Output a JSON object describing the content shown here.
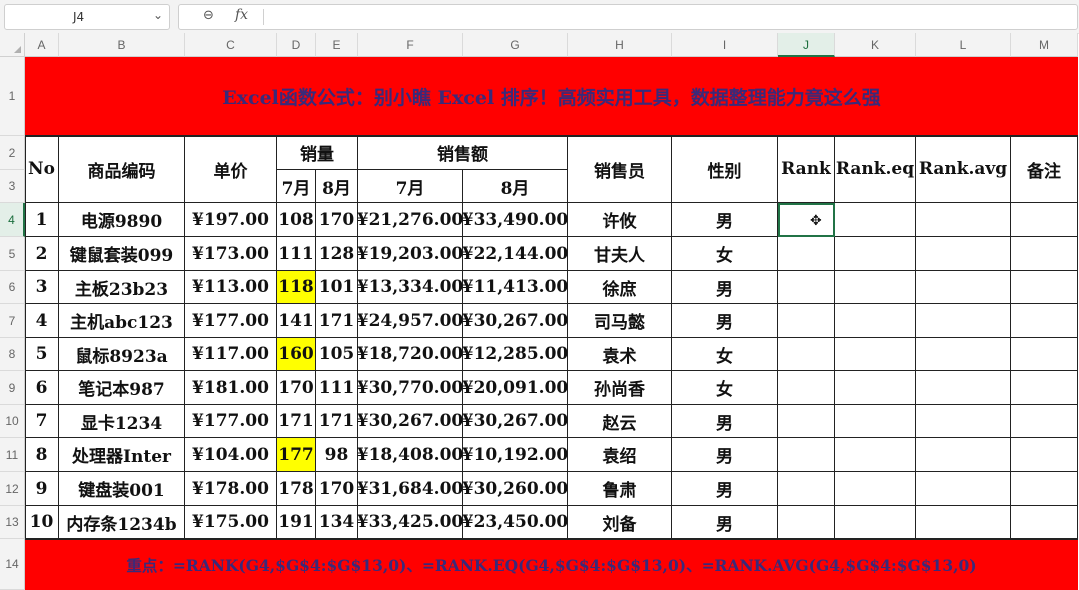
{
  "name_box": "J4",
  "formula": "",
  "columns": [
    "A",
    "B",
    "C",
    "D",
    "E",
    "F",
    "G",
    "H",
    "I",
    "J",
    "K",
    "L",
    "M"
  ],
  "rows": [
    "1",
    "2",
    "3",
    "4",
    "5",
    "6",
    "7",
    "8",
    "9",
    "10",
    "11",
    "12",
    "13",
    "14"
  ],
  "selected_cell": "J4",
  "title": "Excel函数公式：别小瞧 Excel 排序！高频实用工具，数据整理能力竟这么强",
  "headers": {
    "no": "No",
    "code": "商品编码",
    "price": "单价",
    "sales_qty": "销量",
    "sales_amount": "销售额",
    "m7": "7月",
    "m8": "8月",
    "seller": "销售员",
    "gender": "性别",
    "rank": "Rank",
    "rank_eq": "Rank.eq",
    "rank_avg": "Rank.avg",
    "note": "备注"
  },
  "data_rows": [
    {
      "no": "1",
      "code": "电源9890",
      "price": "¥197.00",
      "qty7": "108",
      "qty8": "170",
      "amt7": "¥21,276.00",
      "amt8": "¥33,490.00",
      "seller": "许攸",
      "gender": "男",
      "highlight": false
    },
    {
      "no": "2",
      "code": "键鼠套装099",
      "price": "¥173.00",
      "qty7": "111",
      "qty8": "128",
      "amt7": "¥19,203.00",
      "amt8": "¥22,144.00",
      "seller": "甘夫人",
      "gender": "女",
      "highlight": false
    },
    {
      "no": "3",
      "code": "主板23b23",
      "price": "¥113.00",
      "qty7": "118",
      "qty8": "101",
      "amt7": "¥13,334.00",
      "amt8": "¥11,413.00",
      "seller": "徐庶",
      "gender": "男",
      "highlight": true
    },
    {
      "no": "4",
      "code": "主机abc123",
      "price": "¥177.00",
      "qty7": "141",
      "qty8": "171",
      "amt7": "¥24,957.00",
      "amt8": "¥30,267.00",
      "seller": "司马懿",
      "gender": "男",
      "highlight": false
    },
    {
      "no": "5",
      "code": "鼠标8923a",
      "price": "¥117.00",
      "qty7": "160",
      "qty8": "105",
      "amt7": "¥18,720.00",
      "amt8": "¥12,285.00",
      "seller": "袁术",
      "gender": "女",
      "highlight": true
    },
    {
      "no": "6",
      "code": "笔记本987",
      "price": "¥181.00",
      "qty7": "170",
      "qty8": "111",
      "amt7": "¥30,770.00",
      "amt8": "¥20,091.00",
      "seller": "孙尚香",
      "gender": "女",
      "highlight": false
    },
    {
      "no": "7",
      "code": "显卡1234",
      "price": "¥177.00",
      "qty7": "171",
      "qty8": "171",
      "amt7": "¥30,267.00",
      "amt8": "¥30,267.00",
      "seller": "赵云",
      "gender": "男",
      "highlight": false
    },
    {
      "no": "8",
      "code": "处理器Inter",
      "price": "¥104.00",
      "qty7": "177",
      "qty8": "98",
      "amt7": "¥18,408.00",
      "amt8": "¥10,192.00",
      "seller": "袁绍",
      "gender": "男",
      "highlight": true
    },
    {
      "no": "9",
      "code": "键盘装001",
      "price": "¥178.00",
      "qty7": "178",
      "qty8": "170",
      "amt7": "¥31,684.00",
      "amt8": "¥30,260.00",
      "seller": "鲁肃",
      "gender": "男",
      "highlight": false
    },
    {
      "no": "10",
      "code": "内存条1234b",
      "price": "¥175.00",
      "qty7": "191",
      "qty8": "134",
      "amt7": "¥33,425.00",
      "amt8": "¥23,450.00",
      "seller": "刘备",
      "gender": "男",
      "highlight": false
    }
  ],
  "footer": "重点：=RANK(G4,$G$4:$G$13,0)、=RANK.EQ(G4,$G$4:$G$13,0)、=RANK.AVG(G4,$G$4:$G$13,0)",
  "colors": {
    "banner": "#ff0000",
    "banner_text": "#3a2a7a",
    "highlight": "#ffff00",
    "selection": "#217346"
  },
  "icons": {
    "zoom": "zoom-icon",
    "fx": "function-icon",
    "cursor": "cell-cursor-icon",
    "dropdown": "chevron-down-icon"
  }
}
